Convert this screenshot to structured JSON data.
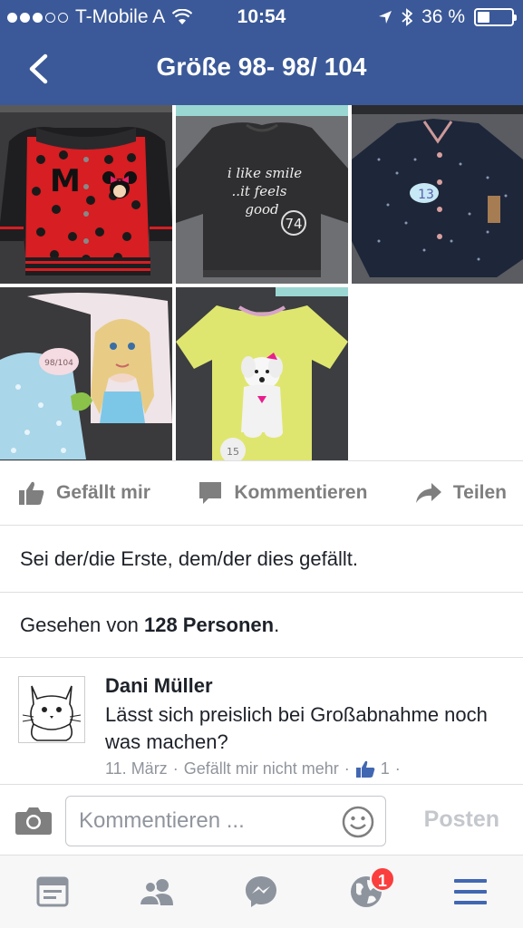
{
  "status_bar": {
    "carrier": "T-Mobile A",
    "time": "10:54",
    "battery": "36 %",
    "battery_level": 0.36
  },
  "header": {
    "title": "Größe 98- 98/ 104"
  },
  "colors": {
    "brand": "#3b5998",
    "like_blue": "#4267b2",
    "badge_red": "#fa3e3e"
  },
  "photos": [
    {
      "name": "red-minnie-jacket"
    },
    {
      "name": "black-shirt-i-like-smile"
    },
    {
      "name": "navy-dotted-blouse"
    },
    {
      "name": "frozen-elsa-pajamas"
    },
    {
      "name": "yellow-dog-tshirt"
    }
  ],
  "photo_text": {
    "shirt_print_1": "i like smile",
    "shirt_print_2": "..it feels",
    "shirt_print_3": "good",
    "tag_74": "74",
    "tag_13": "13",
    "tag_98": "98/104",
    "tag_15": "15"
  },
  "actions": {
    "like": "Gefällt mir",
    "comment": "Kommentieren",
    "share": "Teilen"
  },
  "likes_text": "Sei der/die Erste, dem/der dies gefällt.",
  "seen": {
    "prefix": "Gesehen von ",
    "count": "128 Personen",
    "suffix": "."
  },
  "comment": {
    "author": "Dani Müller",
    "text": "Lässt sich preislich bei Großabnahme noch was machen?",
    "date": "11. März",
    "sep": "·",
    "unlike": "Gefällt mir nicht mehr",
    "like_count": "1"
  },
  "composer": {
    "placeholder": "Kommentieren ...",
    "post": "Posten"
  },
  "tabbar": {
    "notification_count": "1",
    "icons": [
      "news-feed-icon",
      "friends-icon",
      "messenger-icon",
      "globe-icon",
      "menu-icon"
    ]
  }
}
